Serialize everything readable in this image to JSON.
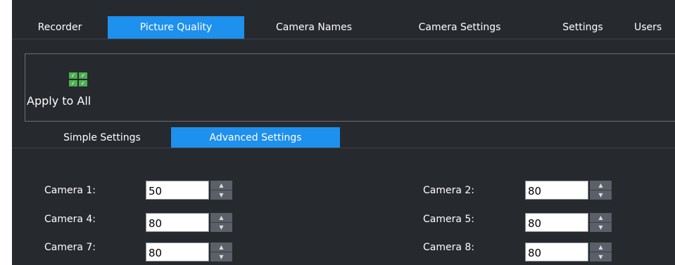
{
  "top_tabs": [
    {
      "label": "Recorder",
      "active": false
    },
    {
      "label": "Picture Quality",
      "active": true
    },
    {
      "label": "Camera Names",
      "active": false
    },
    {
      "label": "Camera Settings",
      "active": false
    },
    {
      "label": "Settings",
      "active": false
    },
    {
      "label": "Users",
      "active": false
    }
  ],
  "toolbar": {
    "apply_all_label": "Apply to All",
    "apply_all_icon": "grid-checkmarks-icon"
  },
  "sub_tabs": [
    {
      "label": "Simple Settings",
      "active": false
    },
    {
      "label": "Advanced Settings",
      "active": true
    }
  ],
  "cameras": [
    {
      "label": "Camera 1:",
      "value": "50"
    },
    {
      "label": "Camera 2:",
      "value": "80"
    },
    {
      "label": "Camera 4:",
      "value": "80"
    },
    {
      "label": "Camera 5:",
      "value": "80"
    },
    {
      "label": "Camera 7:",
      "value": "80"
    },
    {
      "label": "Camera 8:",
      "value": "80"
    }
  ],
  "colors": {
    "background": "#26292e",
    "accent": "#1e90ee",
    "icon_green": "#4caf4f"
  }
}
